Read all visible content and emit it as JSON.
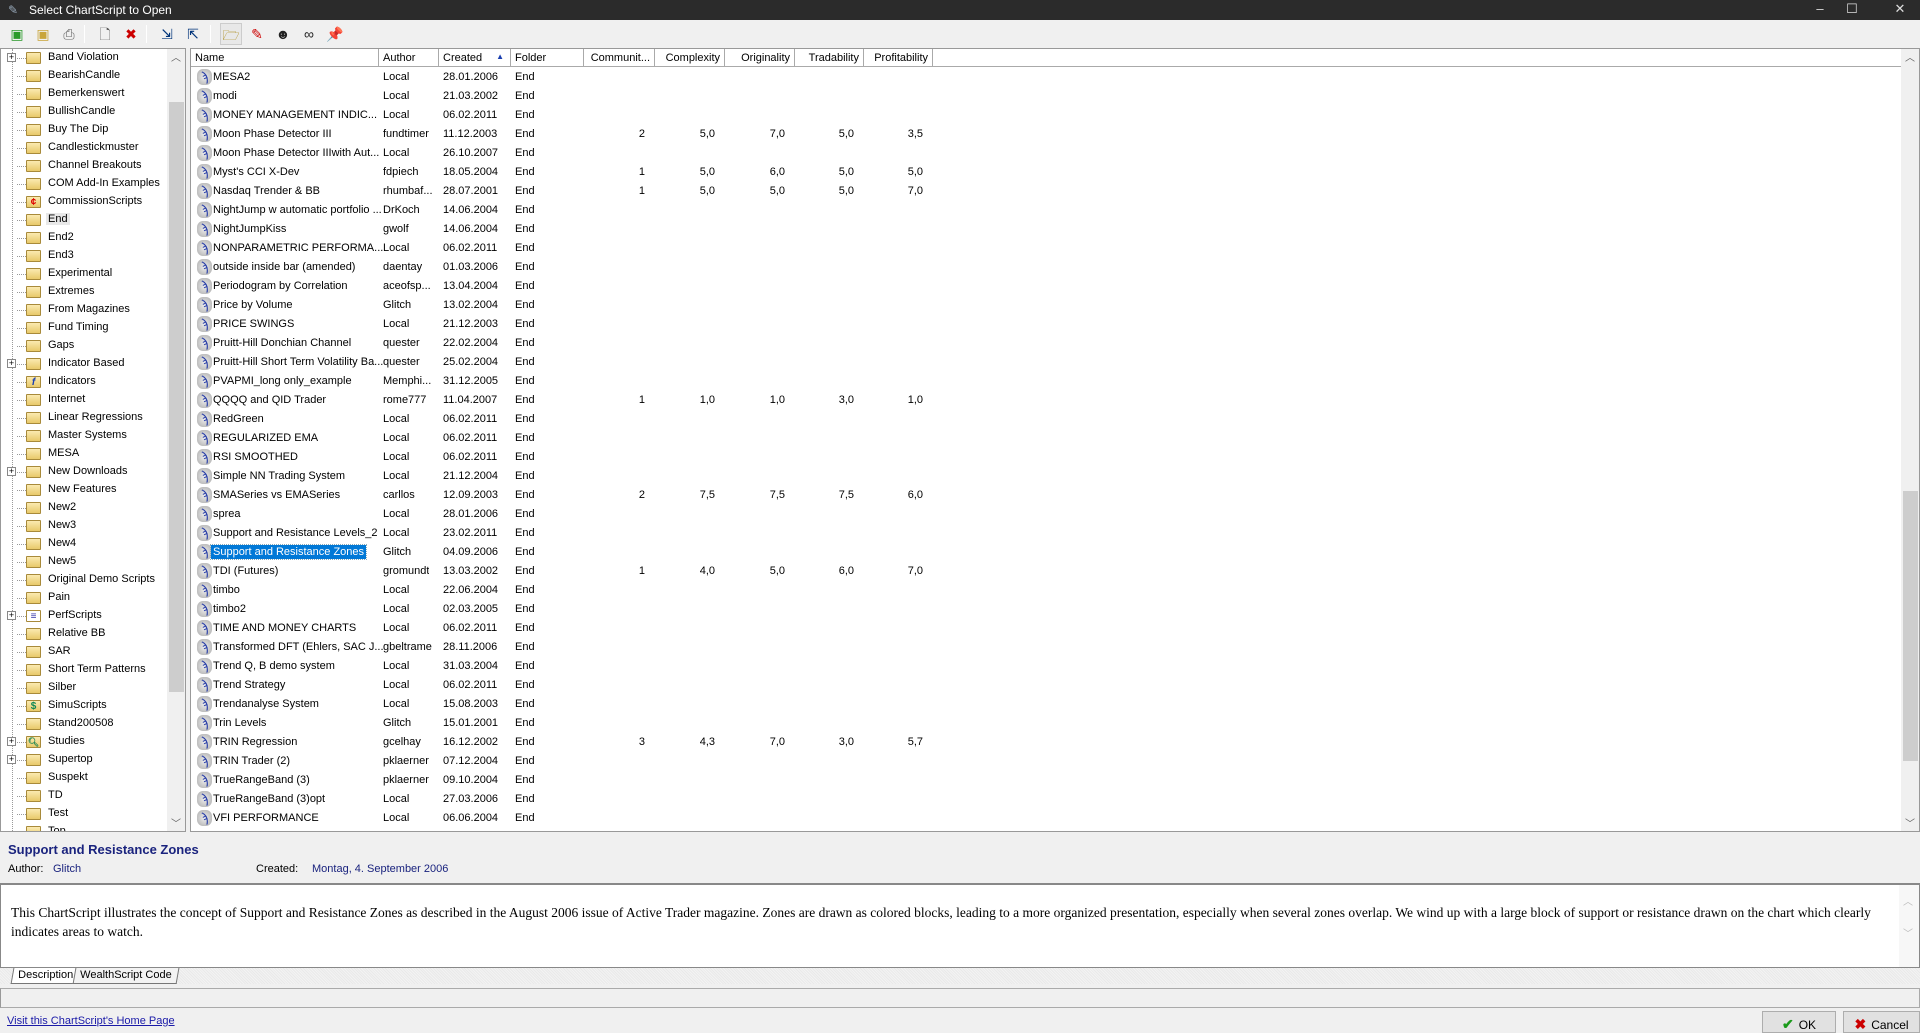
{
  "window": {
    "title": "Select ChartScript to Open"
  },
  "toolbar": {
    "buttons": [
      {
        "name": "new-folder-button",
        "icon": "new-folder-icon",
        "glyph": "▣",
        "color": "#2a9a2a"
      },
      {
        "name": "new-subfolder-button",
        "icon": "new-subfolder-icon",
        "glyph": "▣",
        "color": "#c9a53a"
      },
      {
        "name": "print-button",
        "icon": "printer-icon",
        "glyph": "⎙",
        "color": "#666"
      },
      {
        "name": "new-script-button",
        "icon": "new-document-icon",
        "glyph": "🗋",
        "color": "#555"
      },
      {
        "name": "delete-button",
        "icon": "delete-x-icon",
        "glyph": "✖",
        "color": "#c00"
      },
      {
        "name": "import-button",
        "icon": "import-disk-icon",
        "glyph": "⇲",
        "color": "#00347a"
      },
      {
        "name": "export-button",
        "icon": "export-disk-icon",
        "glyph": "⇱",
        "color": "#00347a"
      },
      {
        "name": "open-folder-button",
        "icon": "open-folder-icon",
        "glyph": "🗁",
        "color": "#a8860e"
      },
      {
        "name": "highlight-button",
        "icon": "flashlight-icon",
        "glyph": "✎",
        "color": "#c00"
      },
      {
        "name": "author-button",
        "icon": "person-icon",
        "glyph": "☻",
        "color": "#222"
      },
      {
        "name": "view-button",
        "icon": "binoculars-icon",
        "glyph": "∞",
        "color": "#222"
      },
      {
        "name": "pin-button",
        "icon": "pushpin-icon",
        "glyph": "📌",
        "color": "#c00"
      }
    ]
  },
  "tree": {
    "items": [
      {
        "label": "Band Violation",
        "expandable": true
      },
      {
        "label": "BearishCandle"
      },
      {
        "label": "Bemerkenswert"
      },
      {
        "label": "BullishCandle"
      },
      {
        "label": "Buy The Dip"
      },
      {
        "label": "Candlestickmuster"
      },
      {
        "label": "Channel Breakouts"
      },
      {
        "label": "COM Add-In Examples"
      },
      {
        "label": "CommissionScripts",
        "icon": "commission-icon"
      },
      {
        "label": "End",
        "selected": true,
        "icon": "open-folder-icon"
      },
      {
        "label": "End2"
      },
      {
        "label": "End3"
      },
      {
        "label": "Experimental"
      },
      {
        "label": "Extremes"
      },
      {
        "label": "From Magazines"
      },
      {
        "label": "Fund Timing"
      },
      {
        "label": "Gaps"
      },
      {
        "label": "Indicator Based",
        "expandable": true
      },
      {
        "label": "Indicators",
        "icon": "function-icon"
      },
      {
        "label": "Internet"
      },
      {
        "label": "Linear Regressions"
      },
      {
        "label": "Master Systems"
      },
      {
        "label": "MESA"
      },
      {
        "label": "New Downloads",
        "expandable": true
      },
      {
        "label": "New Features"
      },
      {
        "label": "New2"
      },
      {
        "label": "New3"
      },
      {
        "label": "New4"
      },
      {
        "label": "New5"
      },
      {
        "label": "Original Demo Scripts"
      },
      {
        "label": "Pain"
      },
      {
        "label": "PerfScripts",
        "expandable": true,
        "icon": "report-icon"
      },
      {
        "label": "Relative BB"
      },
      {
        "label": "SAR"
      },
      {
        "label": "Short Term Patterns"
      },
      {
        "label": "Silber"
      },
      {
        "label": "SimuScripts",
        "icon": "dollar-icon"
      },
      {
        "label": "Stand200508"
      },
      {
        "label": "Studies",
        "expandable": true,
        "icon": "magnifier-icon"
      },
      {
        "label": "Supertop",
        "expandable": true
      },
      {
        "label": "Suspekt"
      },
      {
        "label": "TD"
      },
      {
        "label": "Test"
      },
      {
        "label": "Top"
      }
    ]
  },
  "list": {
    "columns": [
      "Name",
      "Author",
      "Created",
      "Folder",
      "Communit...",
      "Complexity",
      "Originality",
      "Tradability",
      "Profitability"
    ],
    "sort_indicator": "▲",
    "rows": [
      [
        "MESA2",
        "Local",
        "28.01.2006",
        "End",
        "",
        "",
        "",
        "",
        ""
      ],
      [
        "modi",
        "Local",
        "21.03.2002",
        "End",
        "",
        "",
        "",
        "",
        ""
      ],
      [
        "MONEY MANAGEMENT INDIC...",
        "Local",
        "06.02.2011",
        "End",
        "",
        "",
        "",
        "",
        ""
      ],
      [
        "Moon Phase Detector III",
        "fundtimer",
        "11.12.2003",
        "End",
        "2",
        "5,0",
        "7,0",
        "5,0",
        "3,5"
      ],
      [
        "Moon Phase Detector IIIwith Aut...",
        "Local",
        "26.10.2007",
        "End",
        "",
        "",
        "",
        "",
        ""
      ],
      [
        "Myst's CCI X-Dev",
        "fdpiech",
        "18.05.2004",
        "End",
        "1",
        "5,0",
        "6,0",
        "5,0",
        "5,0"
      ],
      [
        "Nasdaq Trender & BB",
        "rhumbaf...",
        "28.07.2001",
        "End",
        "1",
        "5,0",
        "5,0",
        "5,0",
        "7,0"
      ],
      [
        "NightJump w automatic portfolio ...",
        "DrKoch",
        "14.06.2004",
        "End",
        "",
        "",
        "",
        "",
        ""
      ],
      [
        "NightJumpKiss",
        "gwolf",
        "14.06.2004",
        "End",
        "",
        "",
        "",
        "",
        ""
      ],
      [
        "NONPARAMETRIC PERFORMA...",
        "Local",
        "06.02.2011",
        "End",
        "",
        "",
        "",
        "",
        ""
      ],
      [
        "outside inside bar (amended)",
        "daentay",
        "01.03.2006",
        "End",
        "",
        "",
        "",
        "",
        ""
      ],
      [
        "Periodogram by Correlation",
        "aceofsp...",
        "13.04.2004",
        "End",
        "",
        "",
        "",
        "",
        ""
      ],
      [
        "Price by Volume",
        "Glitch",
        "13.02.2004",
        "End",
        "",
        "",
        "",
        "",
        ""
      ],
      [
        "PRICE SWINGS",
        "Local",
        "21.12.2003",
        "End",
        "",
        "",
        "",
        "",
        ""
      ],
      [
        "Pruitt-Hill Donchian Channel",
        "quester",
        "22.02.2004",
        "End",
        "",
        "",
        "",
        "",
        ""
      ],
      [
        "Pruitt-Hill Short Term Volatility Ba...",
        "quester",
        "25.02.2004",
        "End",
        "",
        "",
        "",
        "",
        ""
      ],
      [
        "PVAPMI_long only_example",
        "Memphi...",
        "31.12.2005",
        "End",
        "",
        "",
        "",
        "",
        ""
      ],
      [
        "QQQQ and QID Trader",
        "rome777",
        "11.04.2007",
        "End",
        "1",
        "1,0",
        "1,0",
        "3,0",
        "1,0"
      ],
      [
        "RedGreen",
        "Local",
        "06.02.2011",
        "End",
        "",
        "",
        "",
        "",
        ""
      ],
      [
        "REGULARIZED EMA",
        "Local",
        "06.02.2011",
        "End",
        "",
        "",
        "",
        "",
        ""
      ],
      [
        "RSI SMOOTHED",
        "Local",
        "06.02.2011",
        "End",
        "",
        "",
        "",
        "",
        ""
      ],
      [
        "Simple NN Trading System",
        "Local",
        "21.12.2004",
        "End",
        "",
        "",
        "",
        "",
        ""
      ],
      [
        "SMASeries vs EMASeries",
        "carllos",
        "12.09.2003",
        "End",
        "2",
        "7,5",
        "7,5",
        "7,5",
        "6,0"
      ],
      [
        "sprea",
        "Local",
        "28.01.2006",
        "End",
        "",
        "",
        "",
        "",
        ""
      ],
      [
        "Support and Resistance Levels_2",
        "Local",
        "23.02.2011",
        "End",
        "",
        "",
        "",
        "",
        ""
      ],
      [
        "Support and Resistance Zones",
        "Glitch",
        "04.09.2006",
        "End",
        "",
        "",
        "",
        "",
        ""
      ],
      [
        "TDI (Futures)",
        "gromundt",
        "13.03.2002",
        "End",
        "1",
        "4,0",
        "5,0",
        "6,0",
        "7,0"
      ],
      [
        "timbo",
        "Local",
        "22.06.2004",
        "End",
        "",
        "",
        "",
        "",
        ""
      ],
      [
        "timbo2",
        "Local",
        "02.03.2005",
        "End",
        "",
        "",
        "",
        "",
        ""
      ],
      [
        "TIME AND MONEY CHARTS",
        "Local",
        "06.02.2011",
        "End",
        "",
        "",
        "",
        "",
        ""
      ],
      [
        "Transformed DFT (Ehlers, SAC J...",
        "gbeltrame",
        "28.11.2006",
        "End",
        "",
        "",
        "",
        "",
        ""
      ],
      [
        "Trend Q, B demo system",
        "Local",
        "31.03.2004",
        "End",
        "",
        "",
        "",
        "",
        ""
      ],
      [
        "Trend Strategy",
        "Local",
        "06.02.2011",
        "End",
        "",
        "",
        "",
        "",
        ""
      ],
      [
        "Trendanalyse System",
        "Local",
        "15.08.2003",
        "End",
        "",
        "",
        "",
        "",
        ""
      ],
      [
        "Trin Levels",
        "Glitch",
        "15.01.2001",
        "End",
        "",
        "",
        "",
        "",
        ""
      ],
      [
        "TRIN Regression",
        "gcelhay",
        "16.12.2002",
        "End",
        "3",
        "4,3",
        "7,0",
        "3,0",
        "5,7"
      ],
      [
        "TRIN Trader (2)",
        "pklaerner",
        "07.12.2004",
        "End",
        "",
        "",
        "",
        "",
        ""
      ],
      [
        "TrueRangeBand (3)",
        "pklaerner",
        "09.10.2004",
        "End",
        "",
        "",
        "",
        "",
        ""
      ],
      [
        "TrueRangeBand (3)opt",
        "Local",
        "27.03.2006",
        "End",
        "",
        "",
        "",
        "",
        ""
      ],
      [
        "VFI PERFORMANCE",
        "Local",
        "06.06.2004",
        "End",
        "",
        "",
        "",
        "",
        ""
      ]
    ],
    "selected_index": 25
  },
  "details": {
    "title": "Support and Resistance Zones",
    "author_label": "Author:",
    "author": "Glitch",
    "created_label": "Created:",
    "created": "Montag, 4. September 2006",
    "description": "This ChartScript illustrates the concept of Support and Resistance Zones as described in the August 2006 issue of Active Trader magazine. Zones are drawn as colored blocks, leading to a more organized presentation, especially when several zones overlap. We wind up with a large block of support or resistance drawn on the chart which clearly indicates areas to watch."
  },
  "tabs": [
    "Description",
    "WealthScript Code"
  ],
  "footer": {
    "link": "Visit this ChartScript's Home Page",
    "ok": "OK",
    "cancel": "Cancel"
  },
  "colors": {
    "selection": "#0078d7",
    "title_text": "#1a237e",
    "link": "#1a1aa8"
  }
}
